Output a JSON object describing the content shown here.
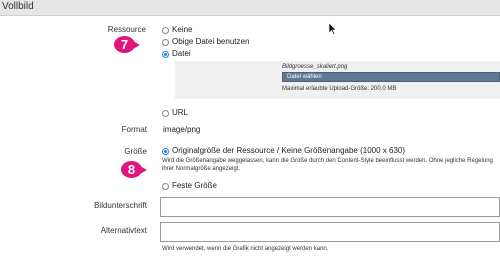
{
  "header": {
    "title": "Vollbild"
  },
  "ressource": {
    "label": "Ressource",
    "options": [
      "Keine",
      "Obige Datei benutzen",
      "Datei",
      "URL"
    ],
    "selected": "Datei",
    "badge": "7",
    "upload": {
      "file_name": "Bildgroesse_skaliert.png",
      "button_label": "Datei wählen",
      "hint": "Maximal erlaubte Upload-Größe: 200.0 MB"
    }
  },
  "format": {
    "label": "Format",
    "value": "image/png"
  },
  "groesse": {
    "label": "Größe",
    "badge": "8",
    "option_original": "Originalgröße der Ressource / Keine Größenangabe (1000 x 630)",
    "help_text_line1": "Wird die Größenangabe weggelassen, kann die Größe durch den Content-Style beeinflusst werden. Ohne jegliche Regelung",
    "help_text_line2": "ihrer Normalgröße angezeigt.",
    "option_fixed": "Feste Größe",
    "selected": "Originalgröße der Ressource / Keine Größenangabe (1000 x 630)"
  },
  "bildunterschrift": {
    "label": "Bildunterschrift",
    "value": ""
  },
  "alternativtext": {
    "label": "Alternativtext",
    "value": "",
    "hint": "Wird verwendet, wenn die Grafik nicht angezeigt werden kann."
  },
  "colors": {
    "badge": "#e0157f",
    "radio_selected": "#2e7fd6",
    "button": "#5e7893",
    "header": "#e6e6e6"
  }
}
